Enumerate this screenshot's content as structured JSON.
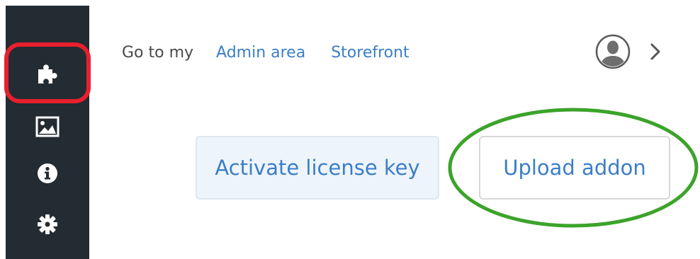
{
  "sidebar": {
    "items": [
      {
        "icon": "puzzle-piece-icon"
      },
      {
        "icon": "image-icon"
      },
      {
        "icon": "info-icon"
      },
      {
        "icon": "gear-icon"
      }
    ]
  },
  "header": {
    "go_to_label": "Go to my",
    "links": [
      {
        "label": "Admin area"
      },
      {
        "label": "Storefront"
      }
    ],
    "user_icon": "user-avatar-icon",
    "chevron_icon": "chevron-right-icon"
  },
  "actions": {
    "activate_label": "Activate license key",
    "upload_label": "Upload addon"
  },
  "colors": {
    "sidebar_bg": "#232b33",
    "link": "#3a7ec8",
    "highlight_red": "#e8202e",
    "highlight_green": "#3ca32b"
  }
}
